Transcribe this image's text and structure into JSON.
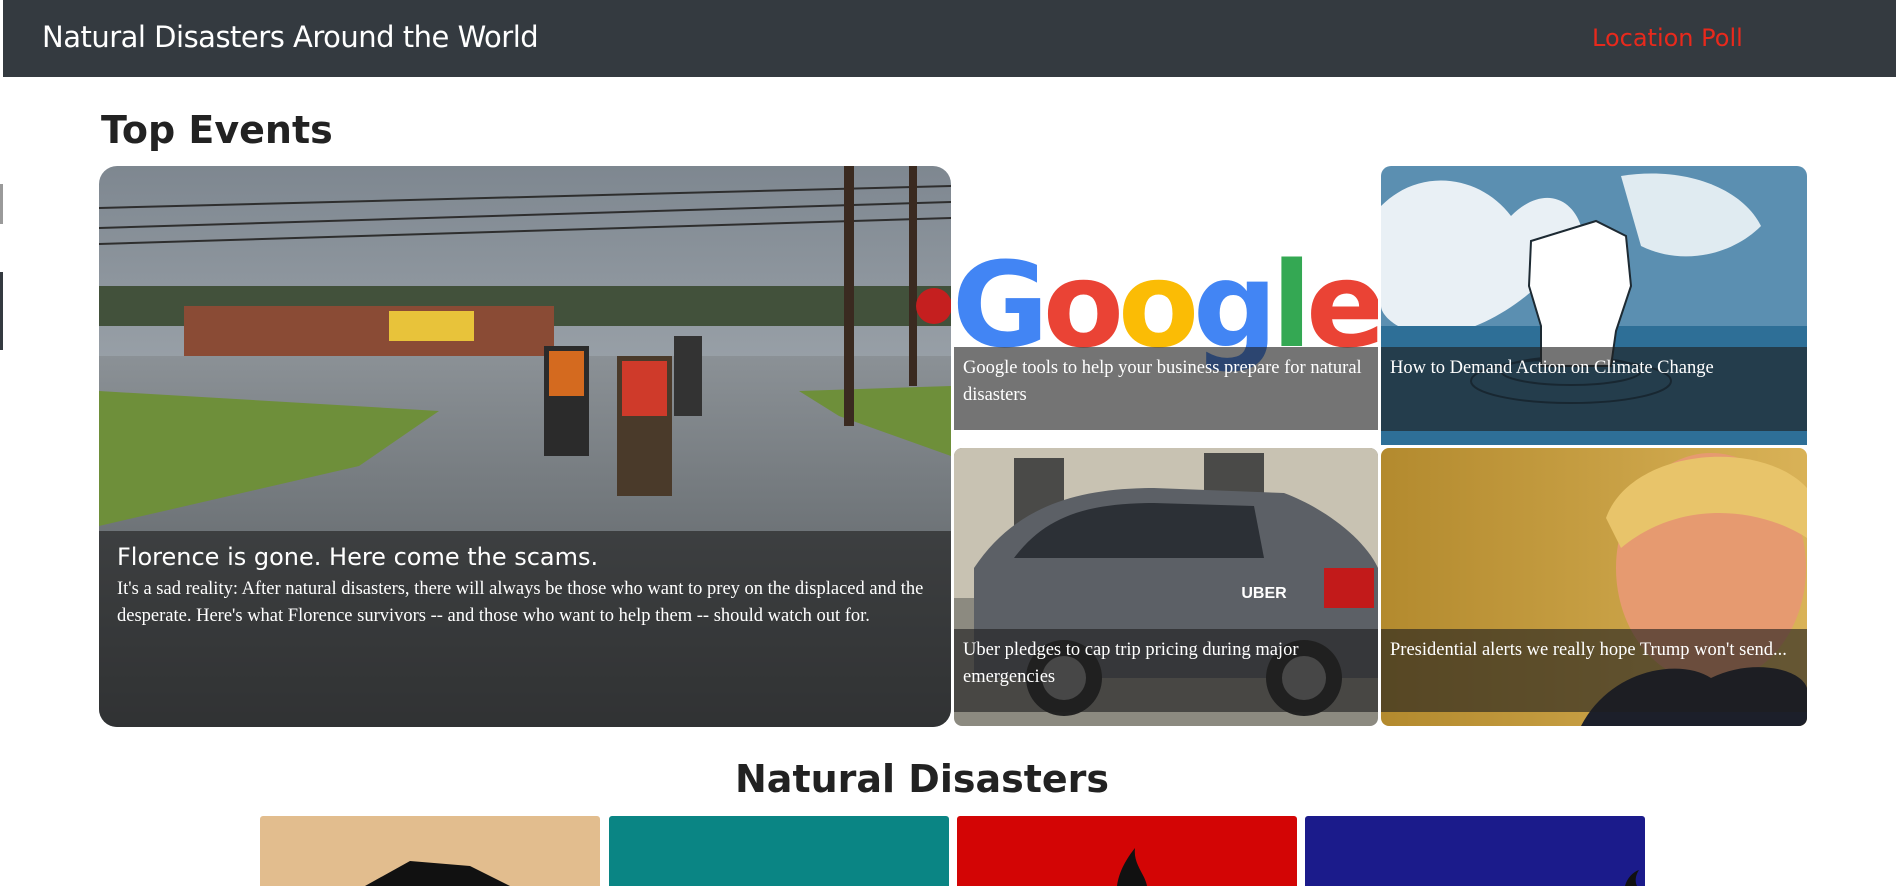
{
  "navbar": {
    "brand": "Natural Disasters Around the World",
    "link": "Location Poll",
    "link_color": "#e8291c",
    "background": "#343a40"
  },
  "top_events": {
    "heading": "Top Events",
    "main": {
      "headline": "Florence is gone. Here come the scams.",
      "summary": "It's a sad reality: After natural disasters, there will always be those who want to prey on the displaced and the desperate. Here's what Florence survivors -- and those who want to help them -- should watch out for."
    },
    "cards": [
      {
        "title": "Google tools to help your business prepare for natural disasters",
        "logo_text": "Google"
      },
      {
        "title": "How to Demand Action on Climate Change"
      },
      {
        "title": "Uber pledges to cap trip pricing during major emergencies",
        "logo_text": "UBER"
      },
      {
        "title": "Presidential alerts we really hope Trump won't send..."
      }
    ]
  },
  "natural_disasters": {
    "heading": "Natural Disasters",
    "tile_colors": [
      "#e2bd8e",
      "#0a8584",
      "#d30505",
      "#1b1b8b"
    ]
  }
}
